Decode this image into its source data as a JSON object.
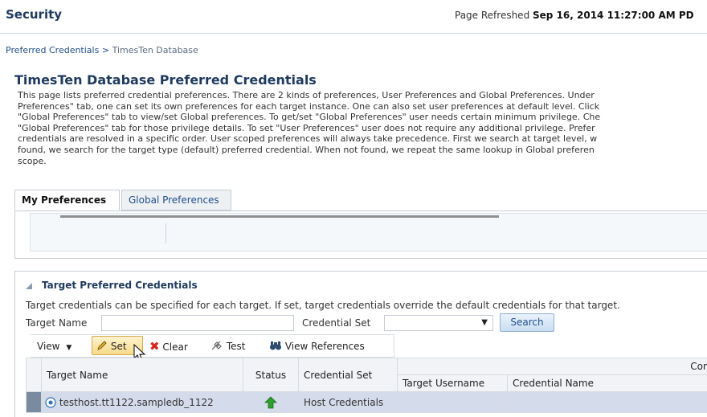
{
  "header": {
    "title": "Security",
    "refresh_label": "Page Refreshed",
    "refresh_time": "Sep 16, 2014 11:27:00 AM PD"
  },
  "breadcrumb": {
    "parent": "Preferred Credentials",
    "separator": ">",
    "current": "TimesTen Database"
  },
  "page": {
    "heading": "TimesTen Database Preferred Credentials",
    "description_lines": [
      "This page lists preferred credential preferences. There are 2 kinds of preferences, User Preferences and Global Preferences. Under",
      "Preferences\" tab, one can set its own preferences for each target instance. One can also set user preferences at default level. Click",
      "\"Global Preferences\" tab to view/set Global preferences. To get/set \"Global Preferences\" user needs certain minimum privilege. Che",
      "\"Global Preferences\" tab for those privilege details. To set \"User Preferences\" user does not require any additional privilege. Prefer",
      "credentials are resolved in a specific order. User scoped preferences will always take precedence. First we search at target level, w",
      "found, we search for the target type (default) preferred credential. When not found, we repeat the same lookup in Global preferen",
      "scope."
    ]
  },
  "tabs": [
    {
      "label": "My Preferences",
      "active": true
    },
    {
      "label": "Global Preferences",
      "active": false
    }
  ],
  "section": {
    "title": "Target Preferred Credentials",
    "description": "Target credentials can be specified for each target. If set, target credentials override the default credentials for that target.",
    "target_name_label": "Target Name",
    "target_name_value": "",
    "credential_set_label": "Credential Set",
    "credential_set_value": "",
    "search_label": "Search"
  },
  "toolbar": {
    "view_label": "View",
    "set_label": "Set",
    "clear_label": "Clear",
    "test_label": "Test",
    "view_refs_label": "View References"
  },
  "table": {
    "group_header": "Configured",
    "columns": {
      "target_name": "Target Name",
      "status": "Status",
      "credential_set": "Credential Set",
      "target_username": "Target Username",
      "credential_name": "Credential Name"
    },
    "rows": [
      {
        "target_name": "testhost.tt1122.sampledb_1122",
        "status": "up",
        "credential_set": "Host Credentials",
        "target_username": "",
        "credential_name": ""
      }
    ]
  },
  "colors": {
    "heading": "#1e3a5f",
    "link": "#1f4f8a",
    "status_up": "#2e9e2e",
    "clear_icon": "#d9261c"
  }
}
